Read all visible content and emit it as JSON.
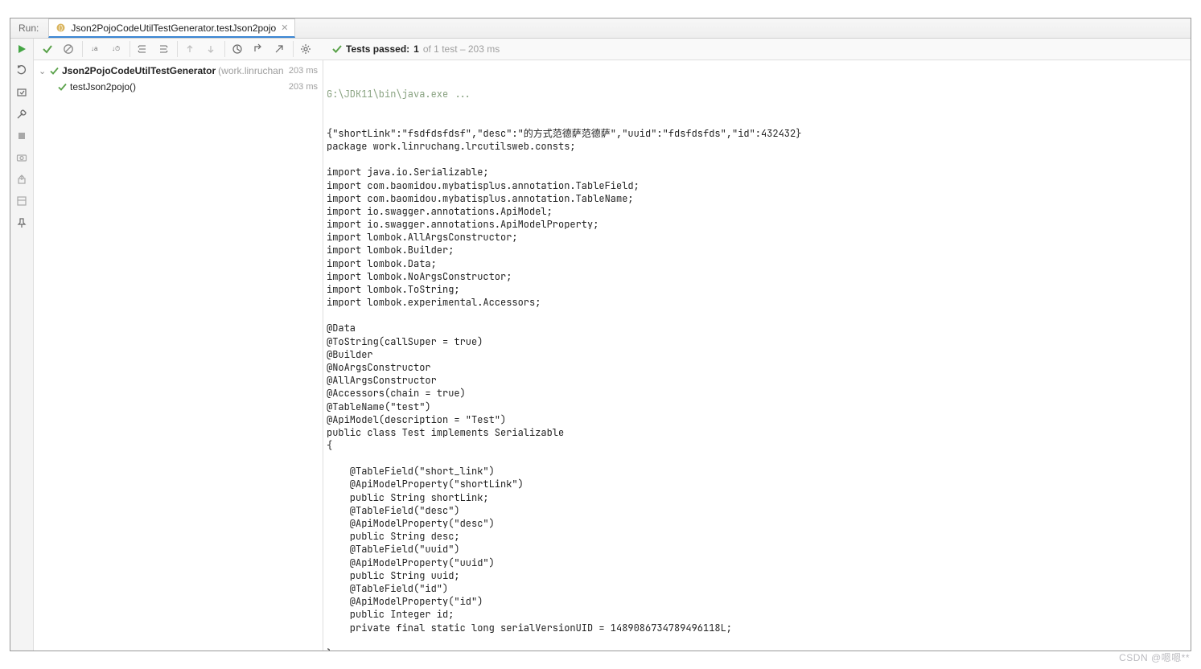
{
  "header": {
    "run_label": "Run:",
    "tab_title": "Json2PojoCodeUtilTestGenerator.testJson2pojo"
  },
  "toolbar": {
    "status_prefix": "Tests passed:",
    "status_count": "1",
    "status_suffix": "of 1 test – 203 ms"
  },
  "tree": {
    "root_label": "Json2PojoCodeUtilTestGenerator",
    "root_detail": "(work.linruchan",
    "root_duration": "203 ms",
    "child_label": "testJson2pojo()",
    "child_duration": "203 ms"
  },
  "console_cmd": "G:\\JDK11\\bin\\java.exe ...",
  "console_lines": [
    "{\"shortLink\":\"fsdfdsfdsf\",\"desc\":\"的方式范德萨范德萨\",\"uuid\":\"fdsfdsfds\",\"id\":432432}",
    "package work.linruchang.lrcutilsweb.consts;",
    "",
    "import java.io.Serializable;",
    "import com.baomidou.mybatisplus.annotation.TableField;",
    "import com.baomidou.mybatisplus.annotation.TableName;",
    "import io.swagger.annotations.ApiModel;",
    "import io.swagger.annotations.ApiModelProperty;",
    "import lombok.AllArgsConstructor;",
    "import lombok.Builder;",
    "import lombok.Data;",
    "import lombok.NoArgsConstructor;",
    "import lombok.ToString;",
    "import lombok.experimental.Accessors;",
    "",
    "@Data",
    "@ToString(callSuper = true)",
    "@Builder",
    "@NoArgsConstructor",
    "@AllArgsConstructor",
    "@Accessors(chain = true)",
    "@TableName(\"test\")",
    "@ApiModel(description = \"Test\")",
    "public class Test implements Serializable",
    "{",
    "",
    "    @TableField(\"short_link\")",
    "    @ApiModelProperty(\"shortLink\")",
    "    public String shortLink;",
    "    @TableField(\"desc\")",
    "    @ApiModelProperty(\"desc\")",
    "    public String desc;",
    "    @TableField(\"uuid\")",
    "    @ApiModelProperty(\"uuid\")",
    "    public String uuid;",
    "    @TableField(\"id\")",
    "    @ApiModelProperty(\"id\")",
    "    public Integer id;",
    "    private final static long serialVersionUID = 1489086734789496118L;",
    "",
    "}"
  ],
  "watermark": "CSDN @嗯嗯**"
}
